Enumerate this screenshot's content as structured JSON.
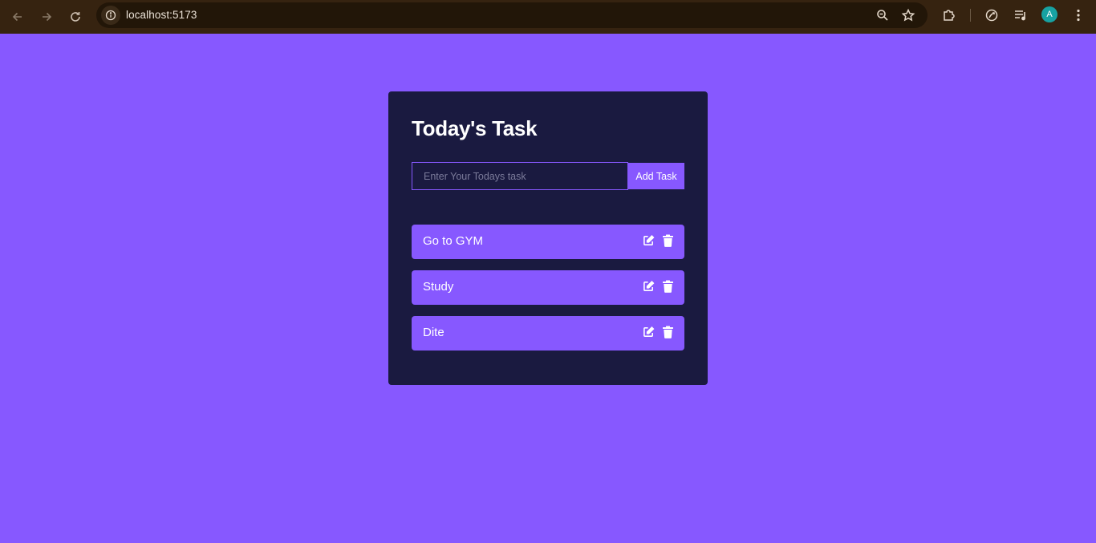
{
  "browser": {
    "url": "localhost:5173",
    "profile_initial": "A",
    "icons": {
      "back": "back-arrow-icon",
      "forward": "forward-arrow-icon",
      "reload": "reload-icon",
      "site_info": "info-icon",
      "zoom": "zoom-icon",
      "bookmark": "star-icon",
      "extensions": "puzzle-icon",
      "performance": "leaf-icon",
      "media": "media-list-icon",
      "menu": "more-vertical-icon"
    },
    "colors": {
      "frame": "#362310",
      "omnibox": "#221608",
      "avatar": "#17a2a2"
    }
  },
  "app": {
    "title": "Today's Task",
    "input": {
      "value": "",
      "placeholder": "Enter Your Todays task"
    },
    "add_button_label": "Add Task",
    "tasks": [
      {
        "text": "Go to GYM"
      },
      {
        "text": "Study"
      },
      {
        "text": "Dite"
      }
    ],
    "task_icons": {
      "edit": "edit-icon",
      "delete": "trash-icon"
    },
    "colors": {
      "page_background": "#8758ff",
      "card_background": "#1a1a40",
      "accent": "#8758ff",
      "text": "#ffffff"
    }
  }
}
